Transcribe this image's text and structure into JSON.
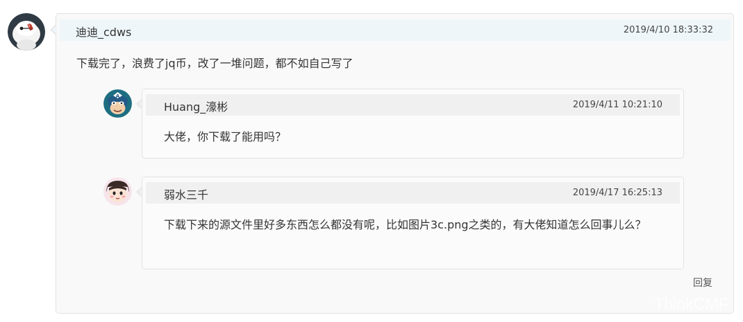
{
  "comment": {
    "author": "迪迪_cdws",
    "time": "2019/4/10 18:33:32",
    "text": "下载完了，浪费了jq币，改了一堆问题，都不如自己写了",
    "reply_label": "回复",
    "avatar_icon": "baymax-avatar-icon"
  },
  "replies": [
    {
      "author": "Huang_濠彬",
      "time": "2019/4/11 10:21:10",
      "text": "大佬，你下载了能用吗？",
      "avatar_icon": "captain-america-avatar-icon"
    },
    {
      "author": "弱水三千",
      "time": "2019/4/17 16:25:13",
      "text": "下载下来的源文件里好多东西怎么都没有呢，比如图片3c.png之类的，有大佬知道怎么回事儿么？",
      "avatar_icon": "cartoon-girl-avatar-icon"
    }
  ],
  "watermark": "ThinkCMF",
  "colors": {
    "main_header_bg": "#eef6f9",
    "reply_header_bg": "#f0f0f0",
    "card_border": "#e2e2e2"
  }
}
